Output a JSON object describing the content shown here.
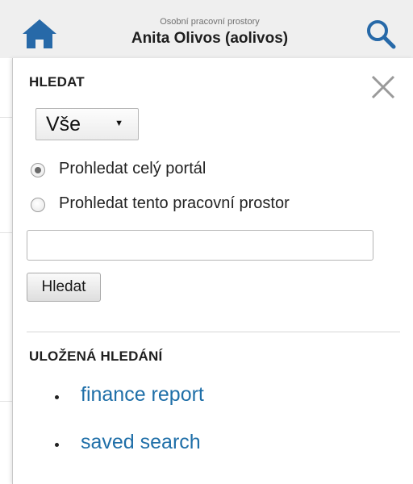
{
  "header": {
    "workspace_label": "Osobní pracovní prostory",
    "user_name": "Anita Olivos (aolivos)",
    "home_icon": "home-icon",
    "search_icon": "search-icon"
  },
  "search_panel": {
    "title": "HLEDAT",
    "close_icon": "close-icon",
    "scope_select": {
      "selected": "Vše"
    },
    "radios": [
      {
        "label": "Prohledat celý portál",
        "checked": true
      },
      {
        "label": "Prohledat tento pracovní prostor",
        "checked": false
      }
    ],
    "query": {
      "value": "",
      "placeholder": ""
    },
    "search_button_label": "Hledat"
  },
  "saved_searches": {
    "title": "ULOŽENÁ HLEDÁNÍ",
    "items": [
      {
        "label": "finance report"
      },
      {
        "label": "saved search"
      }
    ]
  },
  "colors": {
    "accent": "#1f6fa8",
    "header_bg": "#efefef"
  }
}
